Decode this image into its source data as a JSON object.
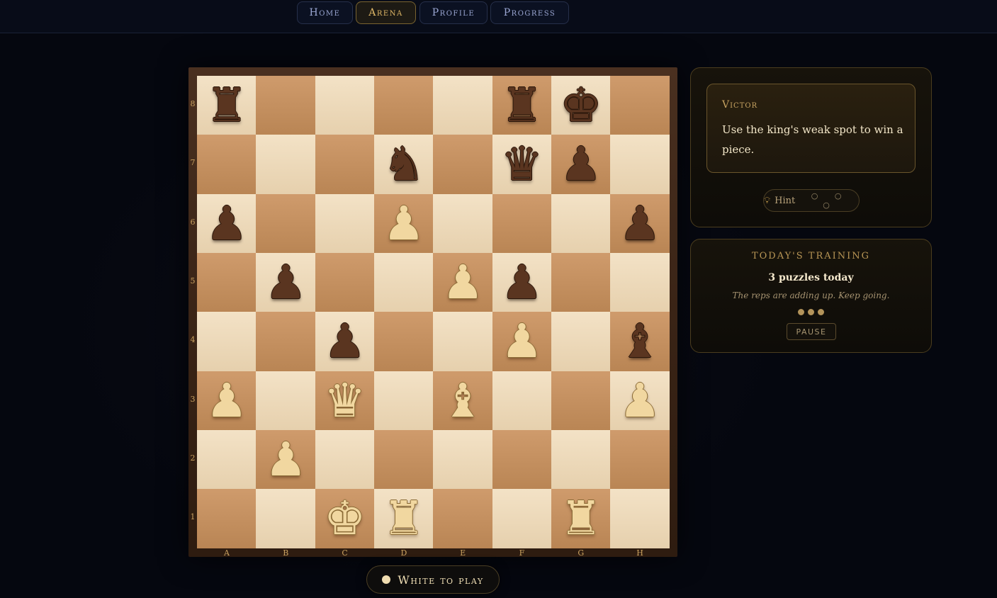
{
  "nav": {
    "items": [
      {
        "label": "Home",
        "active": false
      },
      {
        "label": "Arena",
        "active": true
      },
      {
        "label": "Profile",
        "active": false
      },
      {
        "label": "Progress",
        "active": false
      }
    ]
  },
  "board": {
    "files": [
      "A",
      "B",
      "C",
      "D",
      "E",
      "F",
      "G",
      "H"
    ],
    "ranks": [
      "8",
      "7",
      "6",
      "5",
      "4",
      "3",
      "2",
      "1"
    ],
    "pieces": [
      {
        "square": "a8",
        "color": "black",
        "type": "rook"
      },
      {
        "square": "f8",
        "color": "black",
        "type": "rook"
      },
      {
        "square": "g8",
        "color": "black",
        "type": "king"
      },
      {
        "square": "d7",
        "color": "black",
        "type": "knight"
      },
      {
        "square": "f7",
        "color": "black",
        "type": "queen"
      },
      {
        "square": "g7",
        "color": "black",
        "type": "pawn"
      },
      {
        "square": "a6",
        "color": "black",
        "type": "pawn"
      },
      {
        "square": "d6",
        "color": "white",
        "type": "pawn"
      },
      {
        "square": "h6",
        "color": "black",
        "type": "pawn"
      },
      {
        "square": "b5",
        "color": "black",
        "type": "pawn"
      },
      {
        "square": "e5",
        "color": "white",
        "type": "pawn"
      },
      {
        "square": "f5",
        "color": "black",
        "type": "pawn"
      },
      {
        "square": "c4",
        "color": "black",
        "type": "pawn"
      },
      {
        "square": "f4",
        "color": "white",
        "type": "pawn"
      },
      {
        "square": "h4",
        "color": "black",
        "type": "bishop"
      },
      {
        "square": "a3",
        "color": "white",
        "type": "pawn"
      },
      {
        "square": "c3",
        "color": "white",
        "type": "queen"
      },
      {
        "square": "e3",
        "color": "white",
        "type": "bishop"
      },
      {
        "square": "h3",
        "color": "white",
        "type": "pawn"
      },
      {
        "square": "b2",
        "color": "white",
        "type": "pawn"
      },
      {
        "square": "c1",
        "color": "white",
        "type": "king"
      },
      {
        "square": "d1",
        "color": "white",
        "type": "rook"
      },
      {
        "square": "g1",
        "color": "white",
        "type": "rook"
      }
    ]
  },
  "turn": {
    "label": "White to play",
    "dot_color": "#f0dcb0"
  },
  "coach": {
    "name": "Victor",
    "message": "Use the king's weak spot to win a piece."
  },
  "hint": {
    "label": "Hint",
    "icon": "bulb-icon",
    "dots": "○ ○ ○"
  },
  "training": {
    "title": "TODAY'S TRAINING",
    "count": "3 puzzles today",
    "message": "The reps are adding up. Keep going.",
    "completed_dots": 3,
    "pause_label": "PAUSE"
  },
  "colors": {
    "accent": "#e0b867",
    "light_square": "#f3e2c6",
    "dark_square": "#cf9b6c",
    "background": "#05070f"
  }
}
